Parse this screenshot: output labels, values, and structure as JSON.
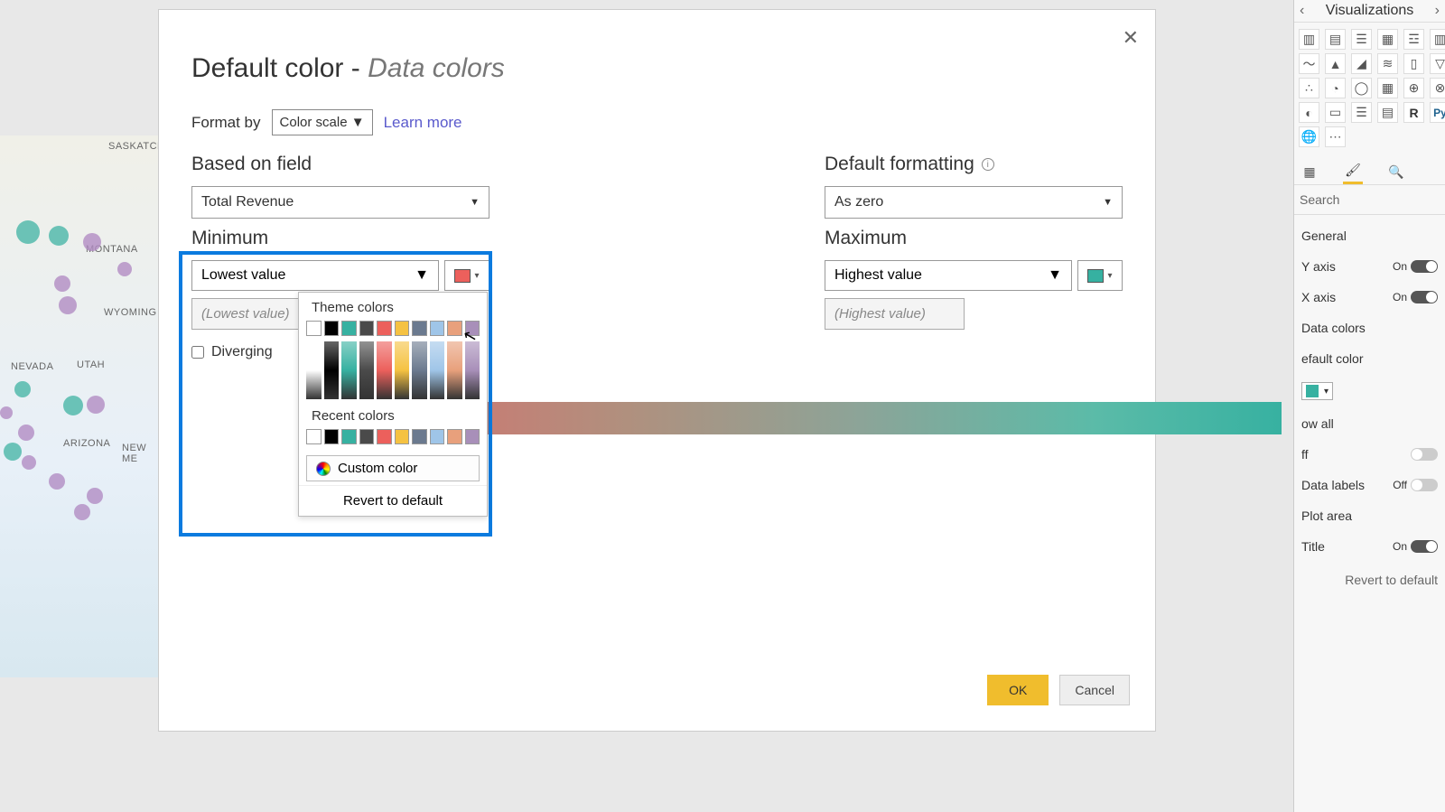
{
  "dialog": {
    "title_pre": "Default color - ",
    "title_em": "Data colors",
    "format_by_label": "Format by",
    "format_by_value": "Color scale",
    "learn_more": "Learn more",
    "based_on_field_label": "Based on field",
    "based_on_field_value": "Total Revenue",
    "default_formatting_label": "Default formatting",
    "default_formatting_value": "As zero",
    "min_label": "Minimum",
    "min_dropdown": "Lowest value",
    "min_placeholder": "(Lowest value)",
    "diverging_label": "Diverging",
    "max_label": "Maximum",
    "max_dropdown": "Highest value",
    "max_placeholder": "(Highest value)",
    "palette": {
      "theme_label": "Theme colors",
      "recent_label": "Recent colors",
      "custom_label": "Custom color",
      "revert_label": "Revert to default",
      "theme_row": [
        "#ffffff",
        "#000000",
        "#37b1a1",
        "#4a4a4a",
        "#ec605c",
        "#f5c242",
        "#6b7a8f",
        "#9fc5e8",
        "#e8a07c",
        "#a88fb9"
      ],
      "recent_row": [
        "#ffffff",
        "#000000",
        "#37b1a1",
        "#4a4a4a",
        "#ec605c",
        "#f5c242",
        "#6b7a8f",
        "#9fc5e8",
        "#e8a07c",
        "#a88fb9"
      ]
    },
    "ok": "OK",
    "cancel": "Cancel",
    "min_color": "#ec605c",
    "max_color": "#37b1a1"
  },
  "map": {
    "labels": [
      "SASKATCH",
      "MONTANA",
      "WYOMING",
      "NEVADA",
      "UTAH",
      "ARIZONA",
      "NEW ME"
    ]
  },
  "right_pane": {
    "title": "Visualizations",
    "search": "Search",
    "items": [
      {
        "label": "General",
        "type": "plain"
      },
      {
        "label": "Y axis",
        "type": "toggle",
        "state": "On"
      },
      {
        "label": "X axis",
        "type": "toggle",
        "state": "On"
      },
      {
        "label": "Data colors",
        "type": "plain"
      },
      {
        "label": "efault color",
        "type": "color"
      },
      {
        "label": "ow all",
        "type": "plain"
      },
      {
        "label": "ff",
        "type": "offtoggle"
      },
      {
        "label": "Data labels",
        "type": "toggle",
        "state": "Off"
      },
      {
        "label": "Plot area",
        "type": "plain"
      },
      {
        "label": "Title",
        "type": "toggle",
        "state": "On"
      }
    ],
    "revert": "Revert to default"
  }
}
